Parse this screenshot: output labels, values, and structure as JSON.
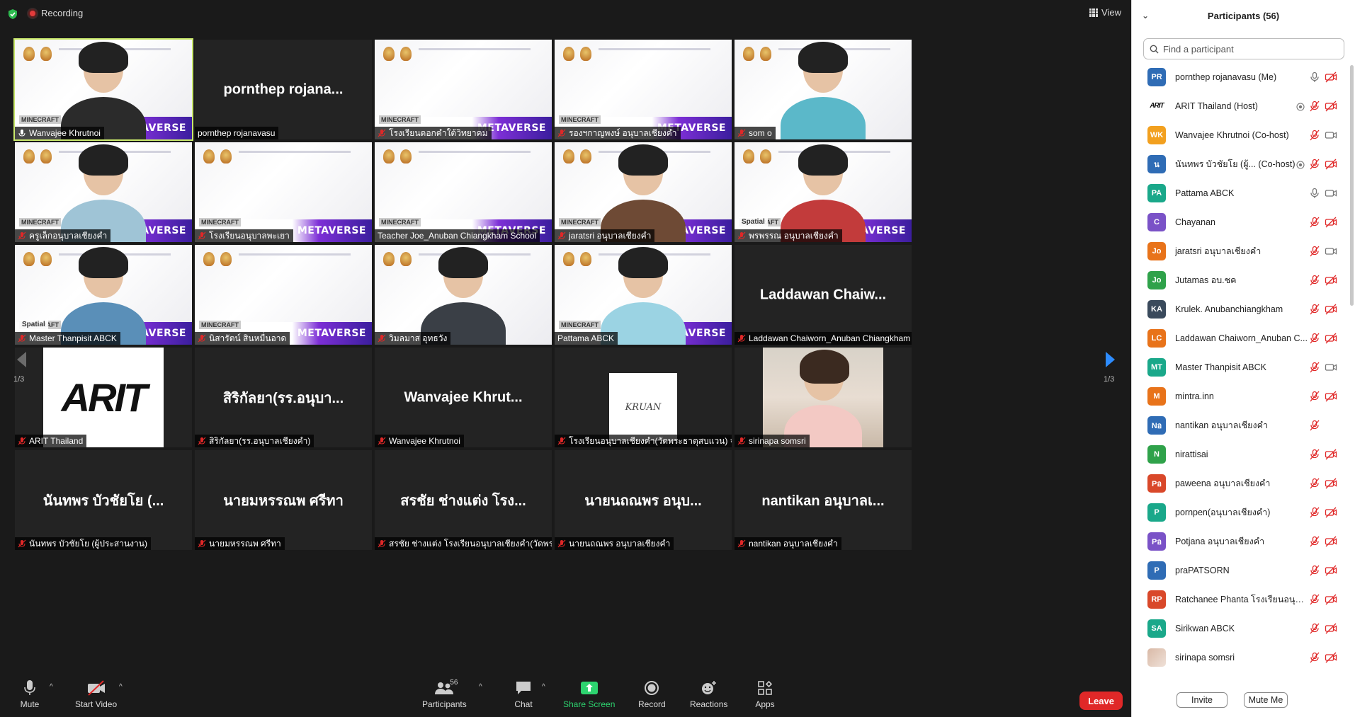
{
  "topbar": {
    "recording_label": "Recording",
    "view_label": "View"
  },
  "grid": {
    "page_indicator": "1/3",
    "tiles": [
      {
        "kind": "video",
        "name": "Wanvajee Khrutnoi",
        "active": true,
        "mic": "on",
        "banner": "METAVERSE",
        "shirt": "#2b2b2b"
      },
      {
        "kind": "name",
        "name": "pornthep rojanavasu",
        "big": "pornthep  rojana...",
        "mic": "none"
      },
      {
        "kind": "slide",
        "name": "โรงเรียนดอกคำใต้วิทยาคม",
        "mic": "muted",
        "banner": "METAVERSE"
      },
      {
        "kind": "slide",
        "name": "รองฯกาญพงษ์ อนุบาลเชียงคำ",
        "mic": "muted",
        "banner": "METAVERSE"
      },
      {
        "kind": "video",
        "name": "som o",
        "mic": "muted",
        "banner": "",
        "shirt": "#5bb8c9"
      },
      {
        "kind": "video",
        "name": "ครูเล็กอนุบาลเชียงคำ",
        "mic": "muted",
        "banner": "METAVERSE",
        "shirt": "#9fc4d6"
      },
      {
        "kind": "slide",
        "name": "โรงเรียนอนุบาลพะเยา",
        "mic": "muted",
        "banner": "METAVERSE"
      },
      {
        "kind": "slide",
        "name": "Teacher Joe_Anuban Chiangkham School",
        "mic": "none",
        "banner": "METAVERSE"
      },
      {
        "kind": "video",
        "name": "jaratsri อนุบาลเชียงคำ",
        "mic": "muted",
        "banner": "METAVERSE",
        "shirt": "#6e4a35"
      },
      {
        "kind": "video",
        "name": "พรพรรณ อนุบาลเชียงคำ",
        "mic": "muted",
        "banner": "METAVERSE",
        "shirt": "#c23b3b",
        "spatial": "Spatial"
      },
      {
        "kind": "video",
        "name": "Master Thanpisit ABCK",
        "mic": "muted",
        "banner": "METAVERSE",
        "shirt": "#5a8fb8",
        "spatial": "Spatial"
      },
      {
        "kind": "slide",
        "name": "นิสารัตน์ สินหมื่นอาด",
        "mic": "muted",
        "banner": "METAVERSE"
      },
      {
        "kind": "video",
        "name": "วิมลมาส อุทธวัง",
        "mic": "muted",
        "banner": "",
        "shirt": "#3a3f46"
      },
      {
        "kind": "video",
        "name": "Pattama ABCK",
        "mic": "none",
        "banner": "METAVERSE",
        "shirt": "#9bd3e3"
      },
      {
        "kind": "name",
        "name": "Laddawan Chaiworn_Anuban Chiangkham Sch...",
        "big": "Laddawan  Chaiw...",
        "mic": "muted"
      },
      {
        "kind": "logo",
        "name": "ARIT Thailand",
        "logo": "ARIT",
        "mic": "muted"
      },
      {
        "kind": "name",
        "name": "สิริกัลยา(รร.อนุบาลเชียงคำ)",
        "big": "สิริกัลยา(รร.อนุบา...",
        "mic": "muted"
      },
      {
        "kind": "name",
        "name": "Wanvajee Khrutnoi",
        "big": "Wanvajee  Khrut...",
        "mic": "muted"
      },
      {
        "kind": "kruan",
        "name": "โรงเรียนอนุบาลเชียงคำ(วัดพระธาตุสบแวน) จ.พะเยา",
        "logo": "KRUAN",
        "mic": "muted"
      },
      {
        "kind": "photo",
        "name": "sirinapa somsri",
        "mic": "muted"
      },
      {
        "kind": "name",
        "name": "นันทพร บัวชัยโย (ผู้ประสานงาน)",
        "big": "นันทพร  บัวชัยโย (...",
        "mic": "muted"
      },
      {
        "kind": "name",
        "name": "นายมหรรณพ ศรีทา",
        "big": "นายมหรรณพ  ศรีทา",
        "mic": "muted"
      },
      {
        "kind": "name",
        "name": "สรชัย ช่างแต่ง โรงเรียนอนุบาลเชียงคำ(วัดพระธาตุสบแวน)",
        "big": "สรชัย ช่างแต่ง โรง...",
        "mic": "muted"
      },
      {
        "kind": "name",
        "name": "นายนถณพร อนุบาลเชียงคำ",
        "big": "นายนถณพร  อนุบ...",
        "mic": "muted"
      },
      {
        "kind": "name",
        "name": "nantikan อนุบาลเชียงคำ",
        "big": "nantikan  อนุบาลเ...",
        "mic": "muted"
      }
    ]
  },
  "toolbar": {
    "mute": "Mute",
    "start_video": "Start Video",
    "participants": "Participants",
    "participants_count": "56",
    "chat": "Chat",
    "share_screen": "Share Screen",
    "record": "Record",
    "reactions": "Reactions",
    "apps": "Apps",
    "leave": "Leave"
  },
  "panel": {
    "title": "Participants (56)",
    "search_placeholder": "Find a participant",
    "invite": "Invite",
    "mute_me": "Mute Me",
    "participants": [
      {
        "initials": "PR",
        "color": "#2f6cb5",
        "name": "pornthep rojanavasu (Me)",
        "mic": "on",
        "video": "off",
        "extra": ""
      },
      {
        "initials": "ARIT",
        "color": "logo",
        "name": "ARIT Thailand (Host)",
        "mic": "muted",
        "video": "off",
        "extra": "rec"
      },
      {
        "initials": "WK",
        "color": "#f2a01f",
        "name": "Wanvajee Khrutnoi (Co-host)",
        "mic": "muted",
        "video": "on",
        "extra": ""
      },
      {
        "initials": "น",
        "color": "#2f6cb5",
        "name": "นันทพร บัวชัยโย (ผู้... (Co-host)",
        "mic": "muted",
        "video": "off",
        "extra": "rec"
      },
      {
        "initials": "PA",
        "color": "#1aa88a",
        "name": "Pattama ABCK",
        "mic": "on",
        "video": "on",
        "extra": ""
      },
      {
        "initials": "C",
        "color": "#7a52c7",
        "name": "Chayanan",
        "mic": "muted",
        "video": "off",
        "extra": ""
      },
      {
        "initials": "Jo",
        "color": "#e8731a",
        "name": "jaratsri อนุบาลเชียงคำ",
        "mic": "muted",
        "video": "on",
        "extra": ""
      },
      {
        "initials": "Jo",
        "color": "#2fa24a",
        "name": "Jutamas อบ.ชค",
        "mic": "muted",
        "video": "off",
        "extra": ""
      },
      {
        "initials": "KA",
        "color": "#3a4a5c",
        "name": "Krulek. Anubanchiangkham",
        "mic": "muted",
        "video": "off",
        "extra": ""
      },
      {
        "initials": "LC",
        "color": "#e8731a",
        "name": "Laddawan Chaiworn_Anuban C...",
        "mic": "muted",
        "video": "off",
        "extra": ""
      },
      {
        "initials": "MT",
        "color": "#1aa88a",
        "name": "Master Thanpisit ABCK",
        "mic": "muted",
        "video": "on",
        "extra": ""
      },
      {
        "initials": "M",
        "color": "#e8731a",
        "name": "mintra.inn",
        "mic": "muted",
        "video": "off",
        "extra": ""
      },
      {
        "initials": "Nอ",
        "color": "#2f6cb5",
        "name": "nantikan อนุบาลเชียงคำ",
        "mic": "muted",
        "video": "none",
        "extra": ""
      },
      {
        "initials": "N",
        "color": "#2fa24a",
        "name": "nirattisai",
        "mic": "muted",
        "video": "off",
        "extra": ""
      },
      {
        "initials": "Pอ",
        "color": "#d9482a",
        "name": "paweena อนุบาลเชียงคำ",
        "mic": "muted",
        "video": "off",
        "extra": ""
      },
      {
        "initials": "P",
        "color": "#1aa88a",
        "name": "pornpen(อนุบาลเชียงคำ)",
        "mic": "muted",
        "video": "off",
        "extra": ""
      },
      {
        "initials": "Pอ",
        "color": "#7a52c7",
        "name": "Potjana อนุบาลเชียงคำ",
        "mic": "muted",
        "video": "off",
        "extra": ""
      },
      {
        "initials": "P",
        "color": "#2f6cb5",
        "name": "praPATSORN",
        "mic": "muted",
        "video": "off",
        "extra": ""
      },
      {
        "initials": "RP",
        "color": "#d9482a",
        "name": "Ratchanee  Phanta โรงเรียนอนุบา...",
        "mic": "muted",
        "video": "off",
        "extra": ""
      },
      {
        "initials": "SA",
        "color": "#1aa88a",
        "name": "Sirikwan ABCK",
        "mic": "muted",
        "video": "off",
        "extra": ""
      },
      {
        "initials": "",
        "color": "photo",
        "name": "sirinapa somsri",
        "mic": "muted",
        "video": "off",
        "extra": ""
      }
    ]
  }
}
